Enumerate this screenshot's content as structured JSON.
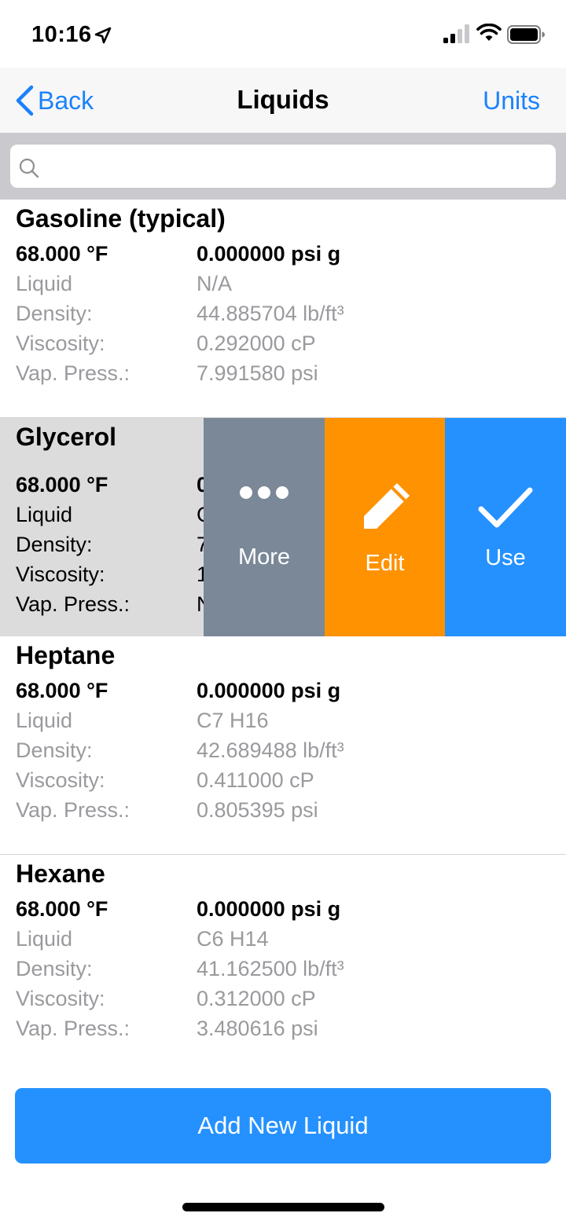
{
  "status_bar": {
    "time": "10:16"
  },
  "nav": {
    "back_label": "Back",
    "title": "Liquids",
    "units_label": "Units"
  },
  "search": {
    "placeholder": ""
  },
  "liquids": [
    {
      "name": "Gasoline (typical)",
      "temperature": "68.000 °F",
      "pressure": "0.000000 psi g",
      "phase": "Liquid",
      "formula": "N/A",
      "density_label": "Density:",
      "density": "44.885704 lb/ft³",
      "viscosity_label": "Viscosity:",
      "viscosity": "0.292000 cP",
      "vap_label": "Vap. Press.:",
      "vap_press": "7.991580 psi"
    },
    {
      "name": "Glycerol",
      "temperature": "68.000 °F",
      "pressure": "0",
      "phase": "Liquid",
      "formula": "C",
      "density_label": "Density:",
      "density": "7",
      "viscosity_label": "Viscosity:",
      "viscosity": "1",
      "vap_label": "Vap. Press.:",
      "vap_press": "N"
    },
    {
      "name": "Heptane",
      "temperature": "68.000 °F",
      "pressure": "0.000000 psi g",
      "phase": "Liquid",
      "formula": "C7 H16",
      "density_label": "Density:",
      "density": "42.689488 lb/ft³",
      "viscosity_label": "Viscosity:",
      "viscosity": "0.411000 cP",
      "vap_label": "Vap. Press.:",
      "vap_press": "0.805395 psi"
    },
    {
      "name": "Hexane",
      "temperature": "68.000 °F",
      "pressure": "0.000000 psi g",
      "phase": "Liquid",
      "formula": "C6 H14",
      "density_label": "Density:",
      "density": "41.162500 lb/ft³",
      "viscosity_label": "Viscosity:",
      "viscosity": "0.312000 cP",
      "vap_label": "Vap. Press.:",
      "vap_press": "3.480616 psi"
    }
  ],
  "swipe_actions": {
    "more_label": "More",
    "edit_label": "Edit",
    "use_label": "Use"
  },
  "add_button": {
    "label": "Add New Liquid"
  },
  "colors": {
    "accent": "#1a82fb",
    "more": "#7a8898",
    "edit": "#fe9200",
    "use": "#2591ff"
  }
}
